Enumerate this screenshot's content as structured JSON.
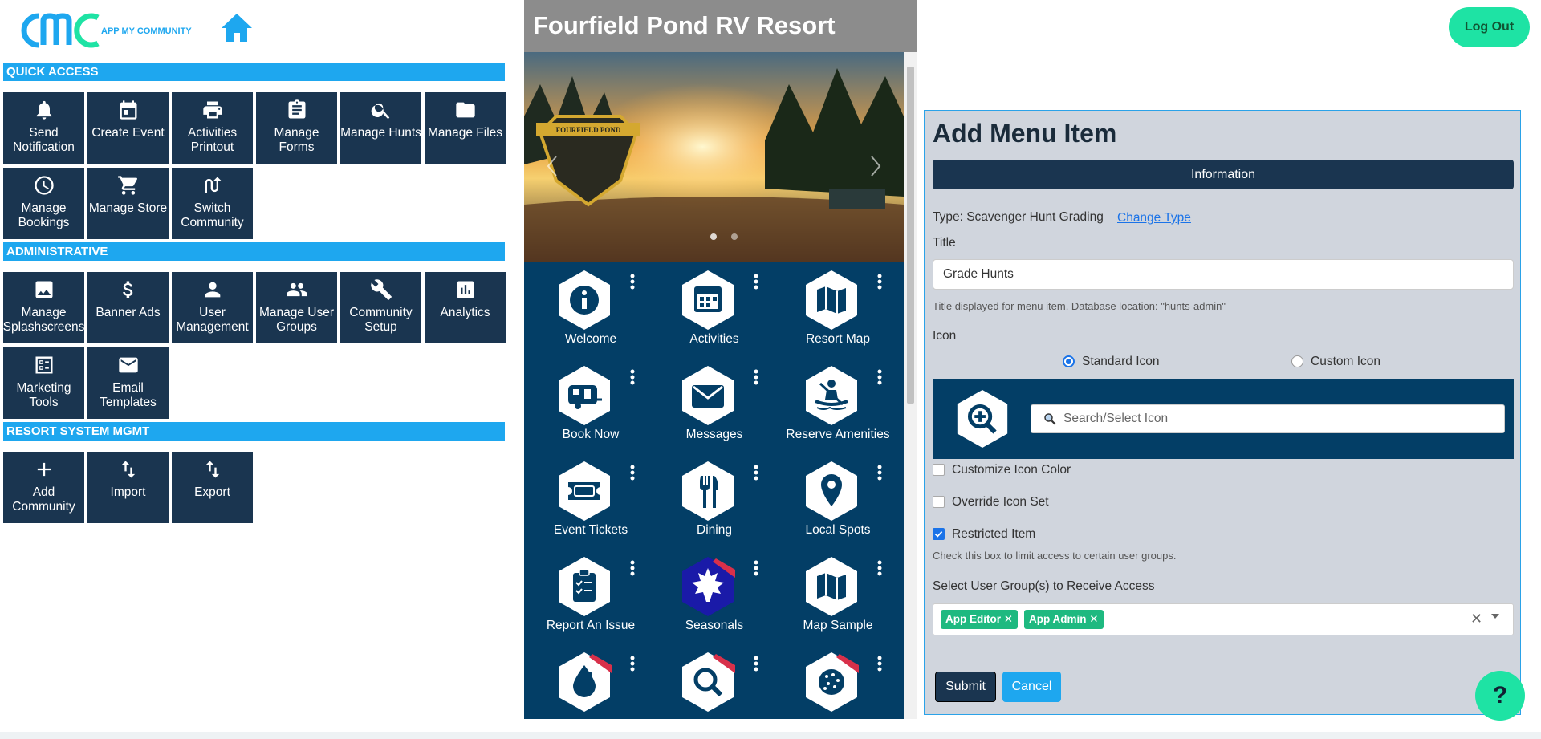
{
  "header": {
    "logo_text": "APP MY COMMUNITY",
    "logout_label": "Log Out"
  },
  "sections": [
    {
      "title": "QUICK ACCESS"
    },
    {
      "title": "ADMINISTRATIVE"
    },
    {
      "title": "RESORT SYSTEM MGMT"
    }
  ],
  "quick_access": [
    {
      "label": "Send Notification",
      "icon": "bell-icon"
    },
    {
      "label": "Create Event",
      "icon": "calendar-icon"
    },
    {
      "label": "Activities Printout",
      "icon": "printer-icon"
    },
    {
      "label": "Manage Forms",
      "icon": "clipboard-icon"
    },
    {
      "label": "Manage Hunts",
      "icon": "search-icon"
    },
    {
      "label": "Manage Files",
      "icon": "folder-icon"
    },
    {
      "label": "Manage Bookings",
      "icon": "clock-icon"
    },
    {
      "label": "Manage Store",
      "icon": "cart-icon"
    },
    {
      "label": "Switch Community",
      "icon": "switch-icon"
    }
  ],
  "administrative": [
    {
      "label": "Manage Splashscreens",
      "icon": "image-icon"
    },
    {
      "label": "Banner Ads",
      "icon": "dollar-icon"
    },
    {
      "label": "User Management",
      "icon": "user-icon"
    },
    {
      "label": "Manage User Groups",
      "icon": "users-icon"
    },
    {
      "label": "Community Setup",
      "icon": "wrench-icon"
    },
    {
      "label": "Analytics",
      "icon": "chart-icon"
    },
    {
      "label": "Marketing Tools",
      "icon": "checklist-icon"
    },
    {
      "label": "Email Templates",
      "icon": "mail-icon"
    }
  ],
  "resort_mgmt": [
    {
      "label": "Add Community",
      "icon": "plus-icon"
    },
    {
      "label": "Import",
      "icon": "import-icon"
    },
    {
      "label": "Export",
      "icon": "export-icon"
    }
  ],
  "phone": {
    "title": "Fourfield Pond RV Resort",
    "banner_logo_text": "FOURFIELD POND",
    "menu_items": [
      {
        "label": "Welcome",
        "icon": "info-icon"
      },
      {
        "label": "Activities",
        "icon": "calendar-icon"
      },
      {
        "label": "Resort Map",
        "icon": "map-icon"
      },
      {
        "label": "Book Now",
        "icon": "camper-icon"
      },
      {
        "label": "Messages",
        "icon": "envelope-icon"
      },
      {
        "label": "Reserve Amenities",
        "icon": "kayak-icon"
      },
      {
        "label": "Event Tickets",
        "icon": "ticket-icon"
      },
      {
        "label": "Dining",
        "icon": "utensils-icon"
      },
      {
        "label": "Local Spots",
        "icon": "pin-icon"
      },
      {
        "label": "Report An Issue",
        "icon": "clipboard-check-icon"
      },
      {
        "label": "Seasonals",
        "icon": "maple-leaf-icon"
      },
      {
        "label": "Map Sample",
        "icon": "map-icon"
      },
      {
        "label": "",
        "icon": "drop-icon"
      },
      {
        "label": "",
        "icon": "magnify-icon"
      },
      {
        "label": "",
        "icon": "ball-icon"
      }
    ]
  },
  "form": {
    "heading": "Add Menu Item",
    "info_tab": "Information",
    "type_text": "Type: Scavenger Hunt Grading",
    "change_type": "Change Type",
    "title_label": "Title",
    "title_value": "Grade Hunts",
    "title_help": "Title displayed for menu item. Database location: \"hunts-admin\"",
    "icon_label": "Icon",
    "standard_icon": "Standard Icon",
    "custom_icon": "Custom Icon",
    "icon_search_placeholder": "Search/Select Icon",
    "customize_color": "Customize Icon Color",
    "override_set": "Override Icon Set",
    "restricted": "Restricted Item",
    "restricted_help": "Check this box to limit access to certain user groups.",
    "groups_label": "Select User Group(s) to Receive Access",
    "groups": [
      "App Editor",
      "App Admin"
    ],
    "submit": "Submit",
    "cancel": "Cancel"
  },
  "help_label": "?",
  "colors": {
    "navy": "#1a3550",
    "accent_blue": "#1ea7ef",
    "accent_green": "#1ee3a4",
    "phone_bg": "#033e66"
  }
}
